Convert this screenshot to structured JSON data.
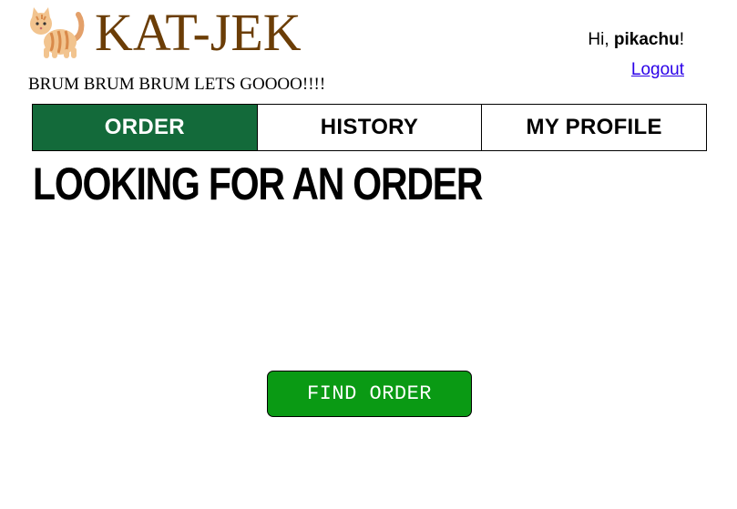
{
  "header": {
    "logo_icon": "cat-icon",
    "app_title": "KAT-JEK",
    "tagline": "BRUM BRUM BRUM LETS GOOOO!!!!",
    "greeting_prefix": "Hi, ",
    "username": "pikachu",
    "greeting_suffix": "!",
    "logout_label": "Logout"
  },
  "nav": {
    "tabs": [
      {
        "label": "ORDER",
        "active": true
      },
      {
        "label": "HISTORY",
        "active": false
      },
      {
        "label": "MY PROFILE",
        "active": false
      }
    ]
  },
  "main": {
    "heading": "LOOKING FOR AN ORDER",
    "find_button_label": "FIND ORDER"
  },
  "colors": {
    "brand_title": "#6b3d06",
    "active_tab": "#136a3a",
    "find_button": "#0a9a14",
    "link": "#2a00e8"
  }
}
